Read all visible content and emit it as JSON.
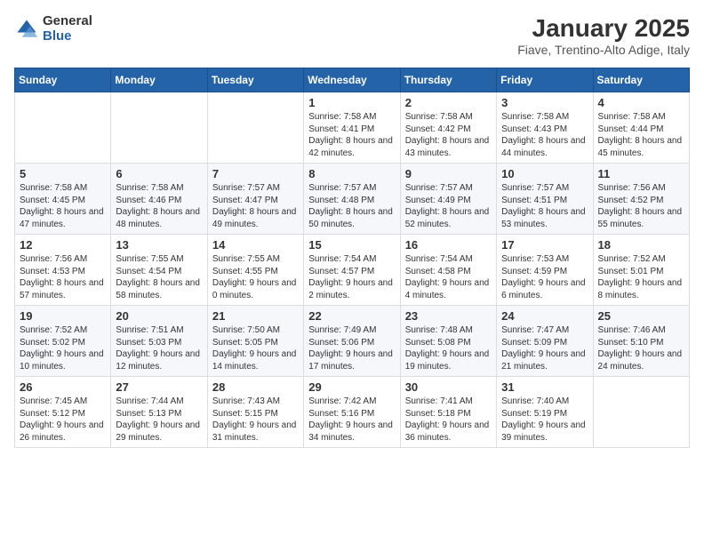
{
  "logo": {
    "general": "General",
    "blue": "Blue"
  },
  "header": {
    "title": "January 2025",
    "subtitle": "Fiave, Trentino-Alto Adige, Italy"
  },
  "weekdays": [
    "Sunday",
    "Monday",
    "Tuesday",
    "Wednesday",
    "Thursday",
    "Friday",
    "Saturday"
  ],
  "weeks": [
    [
      {
        "day": "",
        "info": ""
      },
      {
        "day": "",
        "info": ""
      },
      {
        "day": "",
        "info": ""
      },
      {
        "day": "1",
        "info": "Sunrise: 7:58 AM\nSunset: 4:41 PM\nDaylight: 8 hours and 42 minutes."
      },
      {
        "day": "2",
        "info": "Sunrise: 7:58 AM\nSunset: 4:42 PM\nDaylight: 8 hours and 43 minutes."
      },
      {
        "day": "3",
        "info": "Sunrise: 7:58 AM\nSunset: 4:43 PM\nDaylight: 8 hours and 44 minutes."
      },
      {
        "day": "4",
        "info": "Sunrise: 7:58 AM\nSunset: 4:44 PM\nDaylight: 8 hours and 45 minutes."
      }
    ],
    [
      {
        "day": "5",
        "info": "Sunrise: 7:58 AM\nSunset: 4:45 PM\nDaylight: 8 hours and 47 minutes."
      },
      {
        "day": "6",
        "info": "Sunrise: 7:58 AM\nSunset: 4:46 PM\nDaylight: 8 hours and 48 minutes."
      },
      {
        "day": "7",
        "info": "Sunrise: 7:57 AM\nSunset: 4:47 PM\nDaylight: 8 hours and 49 minutes."
      },
      {
        "day": "8",
        "info": "Sunrise: 7:57 AM\nSunset: 4:48 PM\nDaylight: 8 hours and 50 minutes."
      },
      {
        "day": "9",
        "info": "Sunrise: 7:57 AM\nSunset: 4:49 PM\nDaylight: 8 hours and 52 minutes."
      },
      {
        "day": "10",
        "info": "Sunrise: 7:57 AM\nSunset: 4:51 PM\nDaylight: 8 hours and 53 minutes."
      },
      {
        "day": "11",
        "info": "Sunrise: 7:56 AM\nSunset: 4:52 PM\nDaylight: 8 hours and 55 minutes."
      }
    ],
    [
      {
        "day": "12",
        "info": "Sunrise: 7:56 AM\nSunset: 4:53 PM\nDaylight: 8 hours and 57 minutes."
      },
      {
        "day": "13",
        "info": "Sunrise: 7:55 AM\nSunset: 4:54 PM\nDaylight: 8 hours and 58 minutes."
      },
      {
        "day": "14",
        "info": "Sunrise: 7:55 AM\nSunset: 4:55 PM\nDaylight: 9 hours and 0 minutes."
      },
      {
        "day": "15",
        "info": "Sunrise: 7:54 AM\nSunset: 4:57 PM\nDaylight: 9 hours and 2 minutes."
      },
      {
        "day": "16",
        "info": "Sunrise: 7:54 AM\nSunset: 4:58 PM\nDaylight: 9 hours and 4 minutes."
      },
      {
        "day": "17",
        "info": "Sunrise: 7:53 AM\nSunset: 4:59 PM\nDaylight: 9 hours and 6 minutes."
      },
      {
        "day": "18",
        "info": "Sunrise: 7:52 AM\nSunset: 5:01 PM\nDaylight: 9 hours and 8 minutes."
      }
    ],
    [
      {
        "day": "19",
        "info": "Sunrise: 7:52 AM\nSunset: 5:02 PM\nDaylight: 9 hours and 10 minutes."
      },
      {
        "day": "20",
        "info": "Sunrise: 7:51 AM\nSunset: 5:03 PM\nDaylight: 9 hours and 12 minutes."
      },
      {
        "day": "21",
        "info": "Sunrise: 7:50 AM\nSunset: 5:05 PM\nDaylight: 9 hours and 14 minutes."
      },
      {
        "day": "22",
        "info": "Sunrise: 7:49 AM\nSunset: 5:06 PM\nDaylight: 9 hours and 17 minutes."
      },
      {
        "day": "23",
        "info": "Sunrise: 7:48 AM\nSunset: 5:08 PM\nDaylight: 9 hours and 19 minutes."
      },
      {
        "day": "24",
        "info": "Sunrise: 7:47 AM\nSunset: 5:09 PM\nDaylight: 9 hours and 21 minutes."
      },
      {
        "day": "25",
        "info": "Sunrise: 7:46 AM\nSunset: 5:10 PM\nDaylight: 9 hours and 24 minutes."
      }
    ],
    [
      {
        "day": "26",
        "info": "Sunrise: 7:45 AM\nSunset: 5:12 PM\nDaylight: 9 hours and 26 minutes."
      },
      {
        "day": "27",
        "info": "Sunrise: 7:44 AM\nSunset: 5:13 PM\nDaylight: 9 hours and 29 minutes."
      },
      {
        "day": "28",
        "info": "Sunrise: 7:43 AM\nSunset: 5:15 PM\nDaylight: 9 hours and 31 minutes."
      },
      {
        "day": "29",
        "info": "Sunrise: 7:42 AM\nSunset: 5:16 PM\nDaylight: 9 hours and 34 minutes."
      },
      {
        "day": "30",
        "info": "Sunrise: 7:41 AM\nSunset: 5:18 PM\nDaylight: 9 hours and 36 minutes."
      },
      {
        "day": "31",
        "info": "Sunrise: 7:40 AM\nSunset: 5:19 PM\nDaylight: 9 hours and 39 minutes."
      },
      {
        "day": "",
        "info": ""
      }
    ]
  ]
}
